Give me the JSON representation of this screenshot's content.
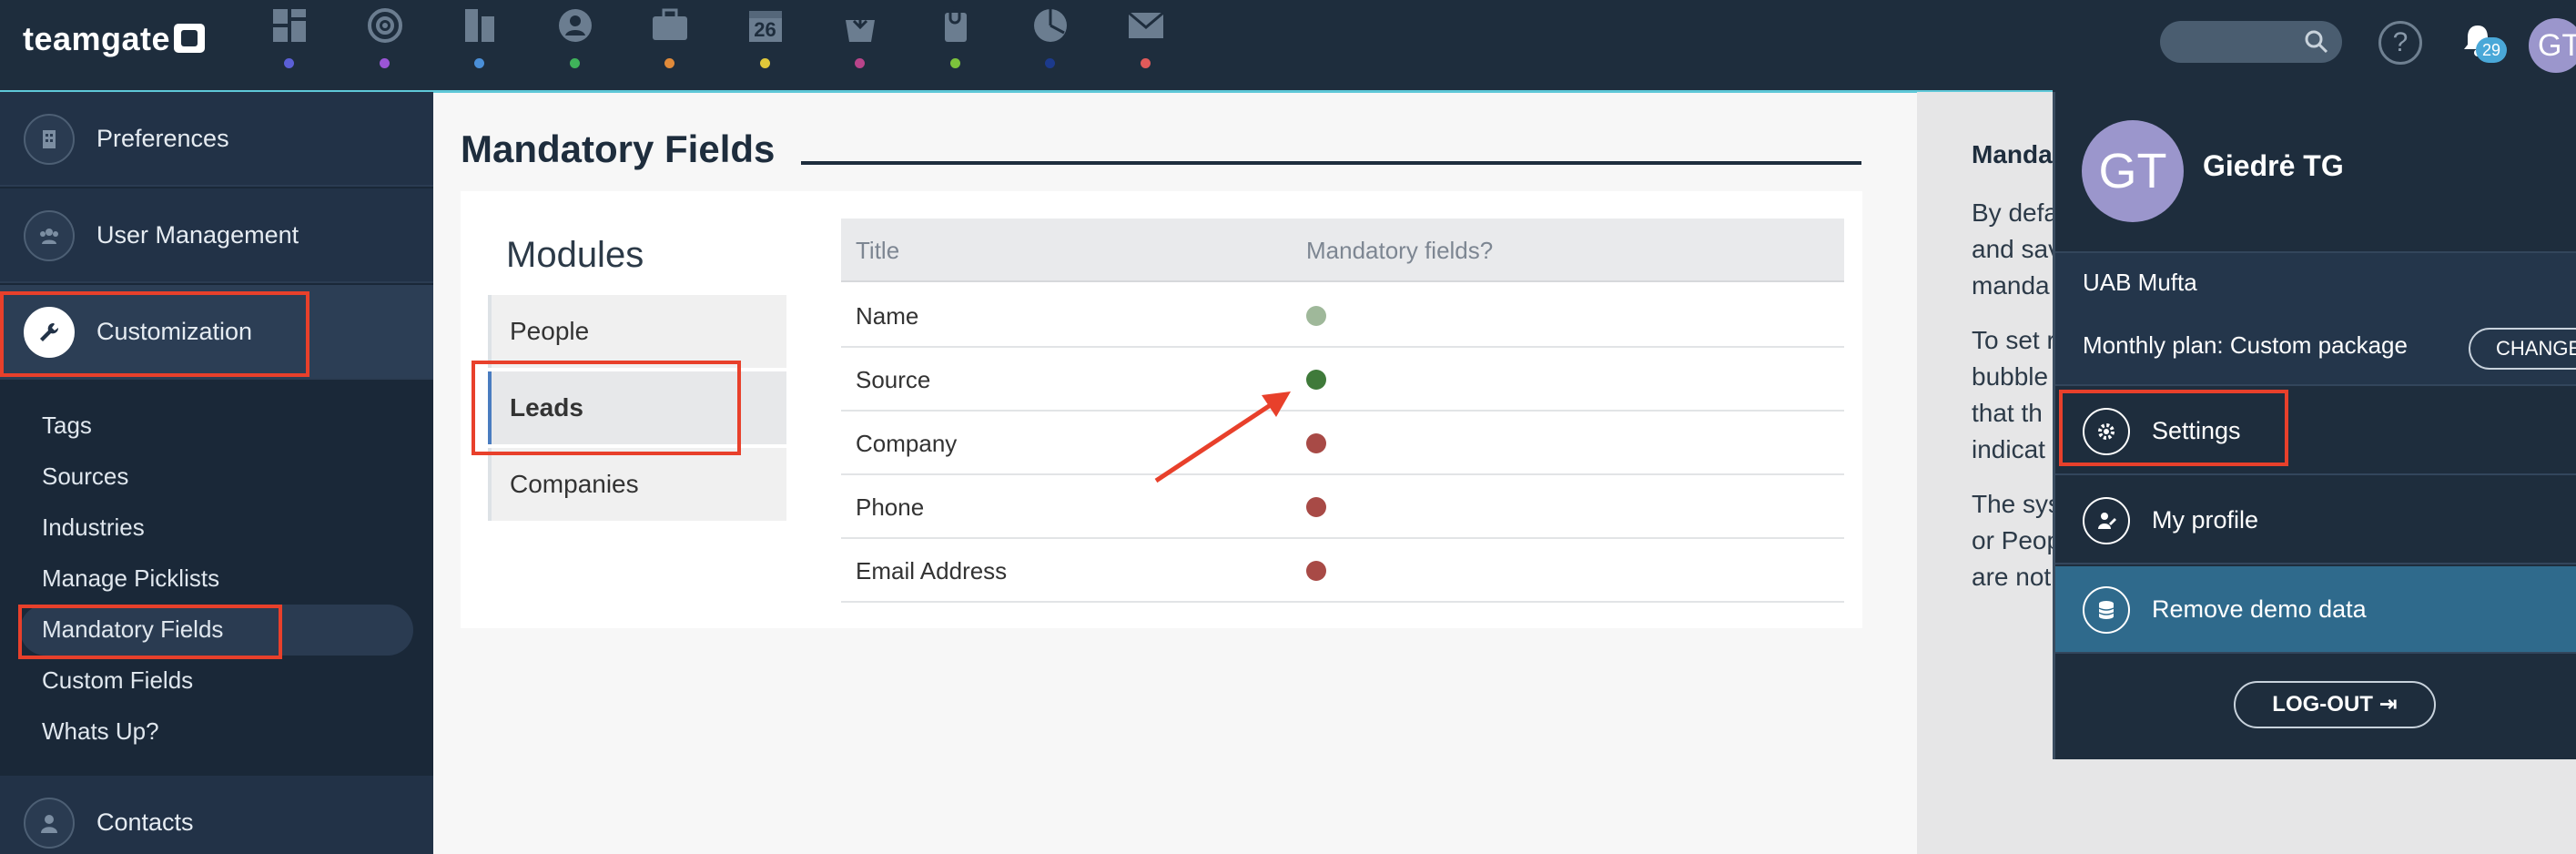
{
  "brand": {
    "logo_text": "teamgate"
  },
  "topnav": {
    "icons": [
      {
        "name": "dashboard-icon",
        "dot": "#5b5fd6"
      },
      {
        "name": "target-icon",
        "dot": "#9a55d6"
      },
      {
        "name": "companies-icon",
        "dot": "#4a8fd8"
      },
      {
        "name": "contacts-icon",
        "dot": "#3fb25a"
      },
      {
        "name": "deals-icon",
        "dot": "#e08a3a"
      },
      {
        "name": "calendar-icon",
        "dot": "#e0c83a",
        "text": "26"
      },
      {
        "name": "inbox-icon",
        "dot": "#b8448a"
      },
      {
        "name": "files-icon",
        "dot": "#7cc23c"
      },
      {
        "name": "reports-icon",
        "dot": "#1c3a8c"
      },
      {
        "name": "email-icon",
        "dot": "#e05a5a"
      }
    ],
    "help_label": "?",
    "notifications_count": "29",
    "avatar_initials": "GT"
  },
  "sidebar": {
    "items": [
      {
        "label": "Preferences",
        "icon": "building-icon"
      },
      {
        "label": "User Management",
        "icon": "users-icon"
      },
      {
        "label": "Customization",
        "icon": "wrench-icon"
      }
    ],
    "subitems": [
      "Tags",
      "Sources",
      "Industries",
      "Manage Picklists",
      "Mandatory Fields",
      "Custom Fields",
      "Whats Up?"
    ],
    "contacts_label": "Contacts"
  },
  "main": {
    "title": "Mandatory Fields",
    "modules_heading": "Modules",
    "modules": [
      "People",
      "Leads",
      "Companies"
    ],
    "table": {
      "headers": [
        "Title",
        "Mandatory fields?"
      ],
      "rows": [
        {
          "title": "Name",
          "status_color": "#9fb89a"
        },
        {
          "title": "Source",
          "status_color": "#3f7a3a"
        },
        {
          "title": "Company",
          "status_color": "#a84a46"
        },
        {
          "title": "Phone",
          "status_color": "#a84a46"
        },
        {
          "title": "Email Address",
          "status_color": "#a84a46"
        }
      ]
    }
  },
  "info": {
    "title": "Manda",
    "lines_1": [
      "By defa",
      "and sav",
      "manda"
    ],
    "lines_2": [
      "To set r",
      "bubble",
      "that th",
      "indicat"
    ],
    "lines_3": [
      "The sys",
      "or Peop",
      "are not"
    ]
  },
  "dropdown": {
    "initials": "GT",
    "name": "Giedrė TG",
    "company": "UAB Mufta",
    "plan": "Monthly plan: Custom package",
    "change_label": "CHANGE",
    "items": [
      "Settings",
      "My profile",
      "Remove demo data"
    ],
    "logout_label": "LOG-OUT"
  }
}
